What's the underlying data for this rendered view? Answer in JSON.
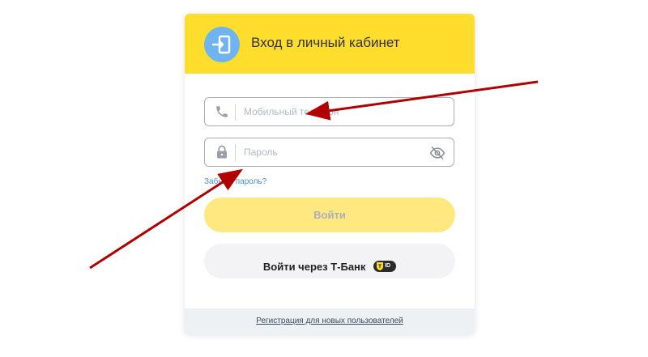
{
  "header": {
    "title": "Вход в личный кабинет",
    "icon": "login-door-icon"
  },
  "form": {
    "phone": {
      "placeholder": "Мобильный телефон",
      "value": "",
      "icon": "phone-icon"
    },
    "password": {
      "placeholder": "Пароль",
      "value": "",
      "icon": "lock-icon",
      "toggle_icon": "eye-off-icon"
    },
    "forgot_label": "Забыли пароль?",
    "login_label": "Войти",
    "tbank_label": "Войти через Т-Банк",
    "tbank_badge": "ID"
  },
  "footer": {
    "register_label": "Регистрация для новых пользователей"
  },
  "colors": {
    "header_bg": "#ffdd2d",
    "login_btn_bg": "#ffe880",
    "icon_circle": "#6db4f0",
    "link": "#4a90d6",
    "arrow": "#b00000"
  }
}
